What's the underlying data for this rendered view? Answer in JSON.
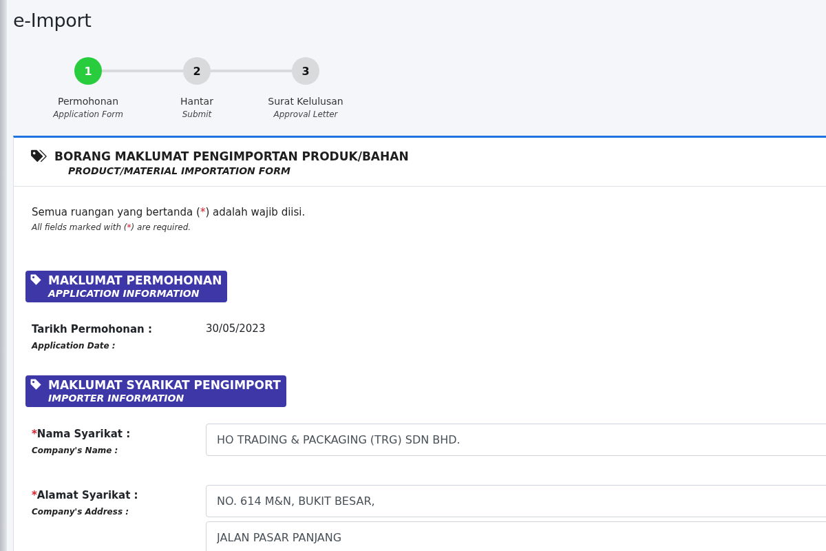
{
  "page_title": "e-Import",
  "steps": [
    {
      "number": "1",
      "label": "Permohonan",
      "sublabel": "Application Form",
      "selected": true
    },
    {
      "number": "2",
      "label": "Hantar",
      "sublabel": "Submit",
      "selected": false
    },
    {
      "number": "3",
      "label": "Surat Kelulusan",
      "sublabel": "Approval Letter",
      "selected": false
    }
  ],
  "form": {
    "title": "BORANG MAKLUMAT PENGIMPORTAN PRODUK/BAHAN",
    "subtitle": "PRODUCT/MATERIAL IMPORTATION FORM",
    "notice": {
      "before": "Semua ruangan yang bertanda (",
      "mark": "*",
      "after": ") adalah wajib diisi."
    },
    "notice_en": {
      "before": "All fields marked with (",
      "mark": "*",
      "after": ") are required."
    },
    "sections": [
      {
        "title": "MAKLUMAT PERMOHONAN",
        "subtitle": "APPLICATION INFORMATION",
        "fields": [
          {
            "kind": "text",
            "label": "Tarikh Permohonan :",
            "sublabel": "Application Date :",
            "values": [
              "30/05/2023"
            ]
          }
        ]
      },
      {
        "title": "MAKLUMAT SYARIKAT PENGIMPORT",
        "subtitle": "IMPORTER INFORMATION",
        "fields": [
          {
            "kind": "input",
            "mark": "*",
            "label": "Nama Syarikat :",
            "sublabel": "Company's Name :",
            "values": [
              "HO TRADING & PACKAGING (TRG) SDN BHD."
            ]
          },
          {
            "kind": "input",
            "mark": "*",
            "label": "Alamat Syarikat :",
            "sublabel": "Company's Address :",
            "values": [
              "NO. 614 M&N, BUKIT BESAR,",
              "JALAN PASAR PANJANG"
            ]
          }
        ]
      }
    ]
  }
}
